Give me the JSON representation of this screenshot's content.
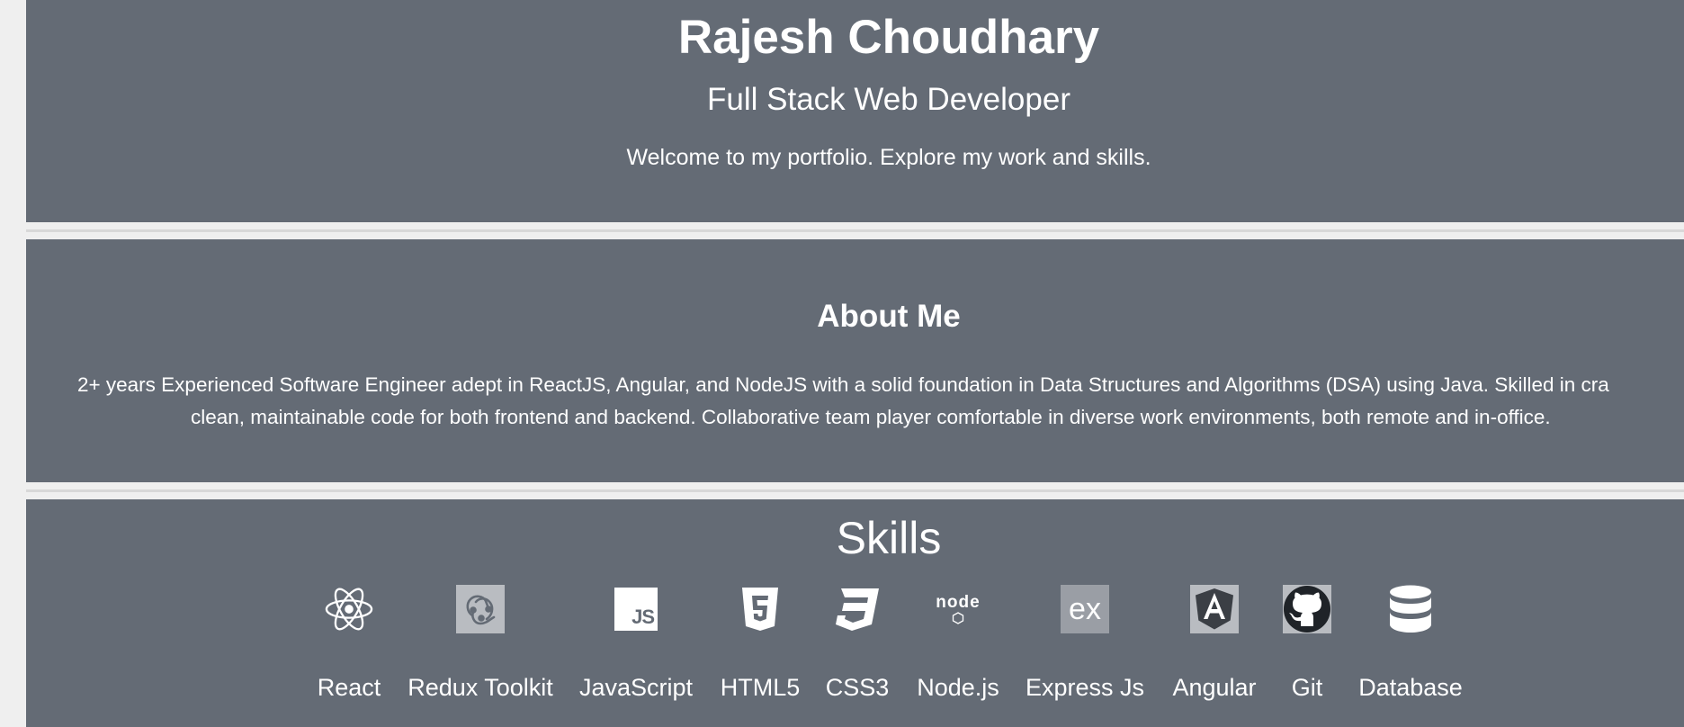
{
  "hero": {
    "name": "Rajesh Choudhary",
    "role": "Full Stack Web Developer",
    "welcome": "Welcome to my portfolio. Explore my work and skills."
  },
  "about": {
    "title": "About Me",
    "line1": "2+ years Experienced Software Engineer adept in ReactJS, Angular, and NodeJS with a solid foundation in Data Structures and Algorithms (DSA) using Java. Skilled in cra",
    "line2": "clean, maintainable code for both frontend and backend. Collaborative team player comfortable in diverse work environments, both remote and in-office."
  },
  "skills": {
    "title": "Skills",
    "items": [
      {
        "label": "React",
        "icon": "react-icon"
      },
      {
        "label": "Redux Toolkit",
        "icon": "redux-icon"
      },
      {
        "label": "JavaScript",
        "icon": "javascript-icon",
        "icon_text": "JS"
      },
      {
        "label": "HTML5",
        "icon": "html5-icon"
      },
      {
        "label": "CSS3",
        "icon": "css3-icon"
      },
      {
        "label": "Node.js",
        "icon": "nodejs-icon",
        "icon_text": "node"
      },
      {
        "label": "Express Js",
        "icon": "express-icon",
        "icon_text": "ex"
      },
      {
        "label": "Angular",
        "icon": "angular-icon"
      },
      {
        "label": "Git",
        "icon": "github-icon"
      },
      {
        "label": "Database",
        "icon": "database-icon"
      }
    ]
  },
  "colors": {
    "section_bg": "#646b75",
    "page_bg": "#efefef",
    "text": "#ffffff"
  }
}
